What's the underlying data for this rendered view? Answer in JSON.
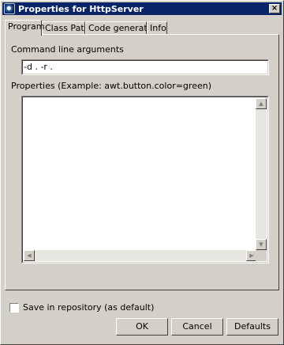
{
  "window": {
    "title": "Properties for HttpServer"
  },
  "tabs": [
    {
      "label": "Program"
    },
    {
      "label": "Class Path"
    },
    {
      "label": "Code generation"
    },
    {
      "label": "Info"
    }
  ],
  "program": {
    "command_line_label": "Command line arguments",
    "command_line_value": "-d . -r .",
    "properties_label": "Properties (Example: awt.button.color=green)",
    "properties_value": ""
  },
  "footer": {
    "save_label": "Save in repository (as default)",
    "save_checked": false,
    "ok_label": "OK",
    "cancel_label": "Cancel",
    "defaults_label": "Defaults"
  },
  "icons": {
    "app": "java-cup-icon",
    "close": "close-icon",
    "scroll_up": "arrow-up-icon",
    "scroll_down": "arrow-down-icon",
    "scroll_left": "arrow-left-icon",
    "scroll_right": "arrow-right-icon"
  },
  "colors": {
    "titlebar": "#0a246a",
    "face": "#d4d0c8"
  }
}
